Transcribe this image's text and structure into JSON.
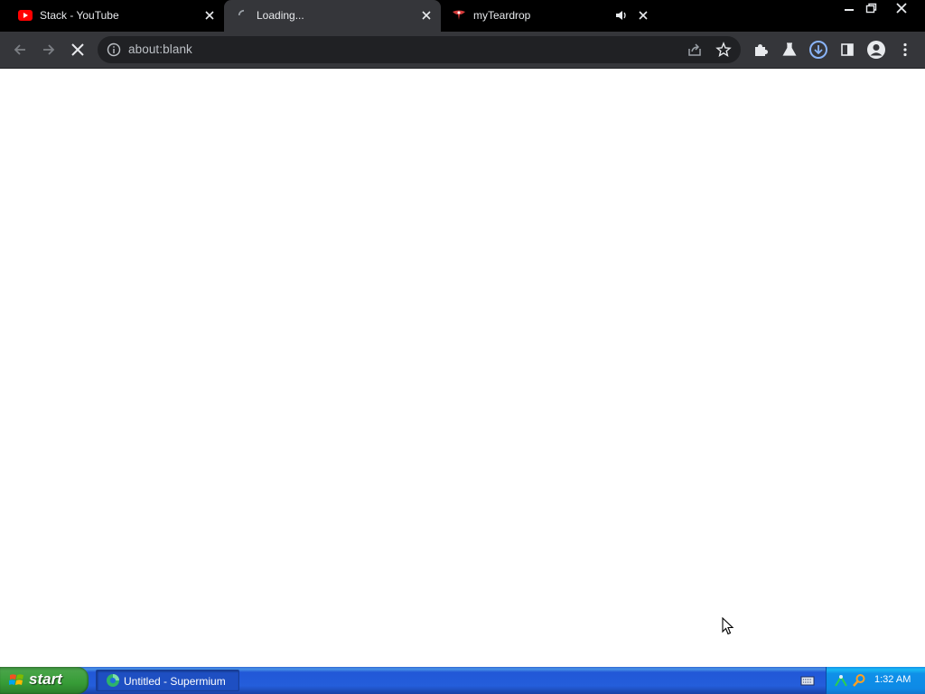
{
  "browser": {
    "tabs": [
      {
        "title": "Stack - YouTube",
        "favicon": "youtube-icon",
        "state": "background"
      },
      {
        "title": "Loading...",
        "favicon": "loading-spinner-icon",
        "state": "active"
      },
      {
        "title": "myTeardrop",
        "favicon": "teardrop-site-icon",
        "state": "background",
        "audio": "audio-playing-icon"
      }
    ],
    "address": {
      "url": "about:blank"
    }
  },
  "taskbar": {
    "start_label": "start",
    "task_item_label": "Untitled - Supermium",
    "clock": "1:32 AM"
  },
  "colors": {
    "tab_strip": "#000000",
    "toolbar": "#35363a",
    "omnibox": "#202124",
    "download_accent": "#8ab4f8",
    "taskbar_blue": "#245edb",
    "start_green": "#379c37"
  }
}
